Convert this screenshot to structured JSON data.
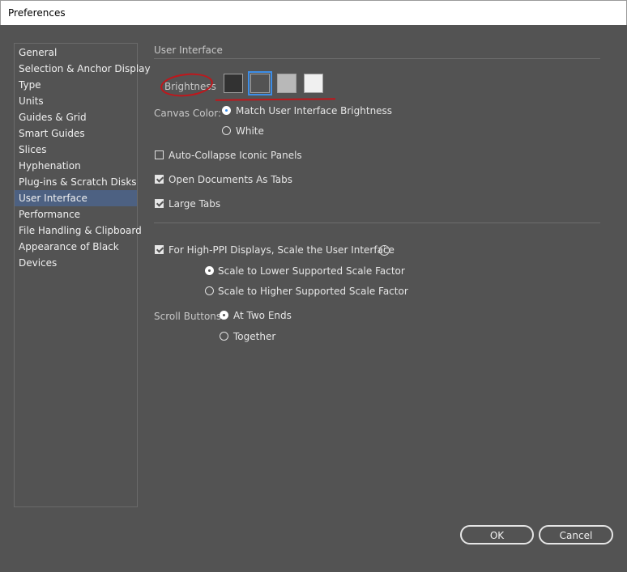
{
  "window": {
    "title": "Preferences"
  },
  "sidebar": {
    "items": [
      {
        "label": "General"
      },
      {
        "label": "Selection & Anchor Display"
      },
      {
        "label": "Type"
      },
      {
        "label": "Units"
      },
      {
        "label": "Guides & Grid"
      },
      {
        "label": "Smart Guides"
      },
      {
        "label": "Slices"
      },
      {
        "label": "Hyphenation"
      },
      {
        "label": "Plug-ins & Scratch Disks"
      },
      {
        "label": "User Interface"
      },
      {
        "label": "Performance"
      },
      {
        "label": "File Handling & Clipboard"
      },
      {
        "label": "Appearance of Black"
      },
      {
        "label": "Devices"
      }
    ],
    "selected": "User Interface"
  },
  "main": {
    "section_title": "User Interface",
    "brightness": {
      "label": "Brightness",
      "swatch_colors": [
        "#323232",
        "#535353",
        "#b8b8b8",
        "#f0f0f0"
      ],
      "selected_index": 1
    },
    "canvas_color": {
      "label": "Canvas Color:",
      "option_match": "Match User Interface Brightness",
      "option_white": "White",
      "selected": "Match User Interface Brightness"
    },
    "checkboxes": {
      "auto_collapse": {
        "label": "Auto-Collapse Iconic Panels",
        "checked": false
      },
      "open_docs_tabs": {
        "label": "Open Documents As Tabs",
        "checked": true
      },
      "large_tabs": {
        "label": "Large Tabs",
        "checked": true
      }
    },
    "high_ppi": {
      "label": "For High-PPI Displays, Scale the User Interface",
      "checked": true,
      "info_icon": "info-icon",
      "option_lower": "Scale to Lower Supported Scale Factor",
      "option_higher": "Scale to Higher Supported Scale Factor",
      "selected": "Scale to Lower Supported Scale Factor"
    },
    "scroll_buttons": {
      "label": "Scroll Buttons:",
      "option_two_ends": "At Two Ends",
      "option_together": "Together",
      "selected": "At Two Ends"
    }
  },
  "footer": {
    "ok_label": "OK",
    "cancel_label": "Cancel"
  },
  "colors": {
    "dialog_bg": "#535353",
    "selection_bg": "#4d6182",
    "accent": "#3d8ee8",
    "annotation": "#c0161b"
  }
}
